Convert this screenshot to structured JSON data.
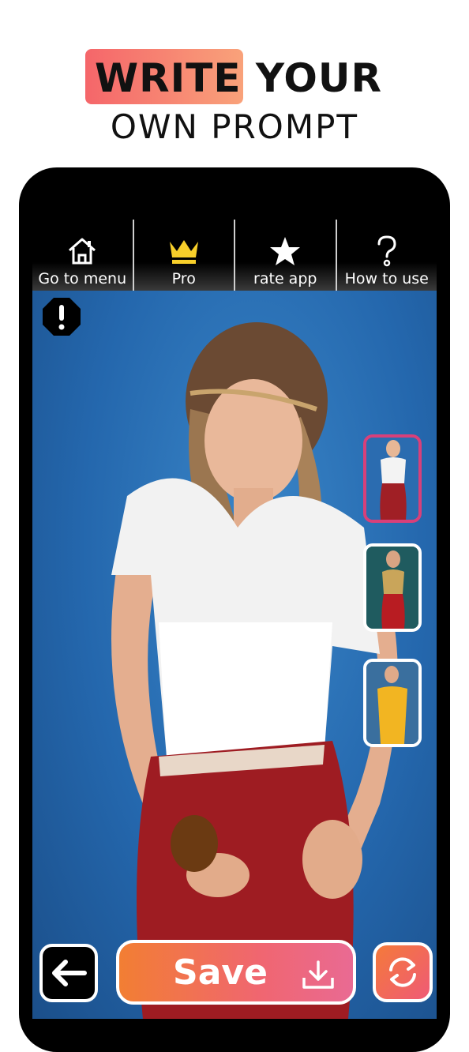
{
  "headline": {
    "line1": "WRITE YOUR",
    "line2": "OWN PROMPT",
    "highlight_color": "#f5666a"
  },
  "toolbar": {
    "items": [
      {
        "label": "Go to menu",
        "icon": "home-icon"
      },
      {
        "label": "Pro",
        "icon": "crown-icon"
      },
      {
        "label": "rate app",
        "icon": "star-icon"
      },
      {
        "label": "How to use",
        "icon": "question-icon"
      }
    ]
  },
  "preview": {
    "warning_icon": "exclamation-octagon-icon",
    "thumbnails": [
      {
        "outfit": "white lace top with red skirt",
        "selected": true
      },
      {
        "outfit": "gold sequin top with red skirt",
        "selected": false
      },
      {
        "outfit": "yellow off-shoulder dress",
        "selected": false
      }
    ]
  },
  "actions": {
    "back_icon": "arrow-left-icon",
    "save_label": "Save",
    "save_icon": "download-icon",
    "refresh_icon": "refresh-icon"
  },
  "colors": {
    "accent_gradient_start": "#f27e33",
    "accent_gradient_end": "#e96a93",
    "selected_thumb": "#d8407a",
    "photo_background": "#2467ad"
  }
}
